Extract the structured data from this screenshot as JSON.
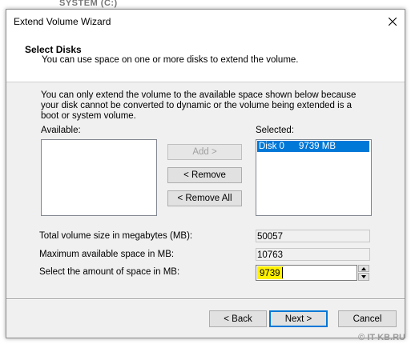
{
  "background": {
    "partial_text": "SYSTEM (C:)"
  },
  "window": {
    "title": "Extend Volume Wizard",
    "close_icon": "close-icon"
  },
  "header": {
    "title": "Select Disks",
    "subtitle": "You can use space on one or more disks to extend the volume."
  },
  "body": {
    "note": "You can only extend the volume to the available space shown below because your disk cannot be converted to dynamic or the volume being extended is a boot or system volume.",
    "available_label": "Available:",
    "selected_label": "Selected:",
    "available_items": [],
    "selected_items": [
      {
        "disk": "Disk 0",
        "size": "9739 MB"
      }
    ],
    "buttons": {
      "add": "Add >",
      "remove": "< Remove",
      "remove_all": "< Remove All"
    },
    "total_label": "Total volume size in megabytes (MB):",
    "total_value": "50057",
    "max_label": "Maximum available space in MB:",
    "max_value": "10763",
    "amount_label": "Select the amount of space in MB:",
    "amount_value": "9739"
  },
  "footer": {
    "back": "< Back",
    "next": "Next >",
    "cancel": "Cancel"
  },
  "watermark": "© IT-KB.RU",
  "colors": {
    "selection": "#0078d7",
    "highlight": "#fff100",
    "dialog_bg": "#f0f0f0"
  }
}
